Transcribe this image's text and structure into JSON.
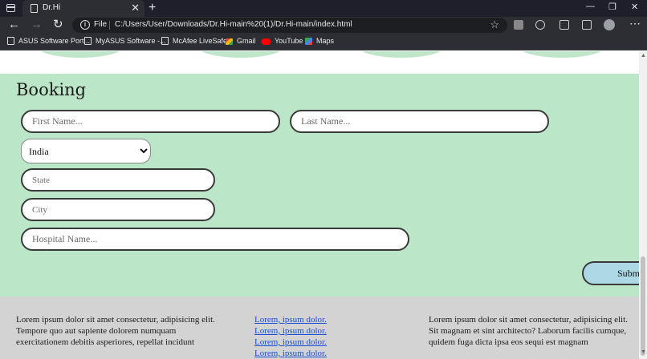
{
  "browser": {
    "tab_title": "Dr.Hi",
    "tab_close": "✕",
    "new_tab": "+",
    "url_scheme_label": "File",
    "url": "C:/Users/User/Downloads/Dr.Hi-main%20(1)/Dr.Hi-main/index.html",
    "window_controls": {
      "minimize": "—",
      "maximize": "❐",
      "close": "✕"
    },
    "bookmarks": [
      "ASUS Software Port...",
      "MyASUS Software -...",
      "McAfee LiveSafe",
      "Gmail",
      "YouTube",
      "Maps"
    ]
  },
  "booking": {
    "heading": "Booking",
    "first_name_placeholder": "First Name...",
    "last_name_placeholder": "Last Name...",
    "country_selected": "India",
    "state_placeholder": "State",
    "city_placeholder": "City",
    "hospital_placeholder": "Hospital Name...",
    "submit_label": "Submit"
  },
  "footer": {
    "col1_text": "Lorem ipsum dolor sit amet consectetur, adipisicing elit. Tempore quo aut sapiente dolorem numquam exercitationem debitis asperiores, repellat incidunt",
    "links": [
      "Lorem, ipsum dolor.",
      "Lorem, ipsum dolor.",
      "Lorem, ipsum dolor.",
      "Lorem, ipsum dolor."
    ],
    "col3_text": "Lorem ipsum dolor sit amet consectetur, adipisicing elit. Sit magnam et sint architecto? Laborum facilis cumque, quidem fuga dicta ipsa eos sequi est magnam"
  },
  "colors": {
    "booking_bg": "#bbe6c7",
    "footer_bg": "#d3d3d3",
    "submit_bg": "#add8e6",
    "link": "#1a4fd6"
  }
}
